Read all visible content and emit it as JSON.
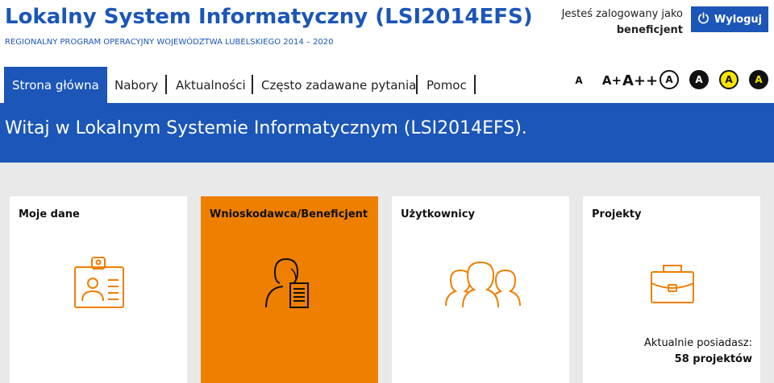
{
  "header": {
    "title": "Lokalny System Informatyczny (LSI2014EFS)",
    "subtitle": "REGIONALNY PROGRAM OPERACYJNY WOJEWÓDZTWA LUBELSKIEGO 2014 – 2020",
    "login_label": "Jesteś zalogowany jako",
    "login_user": "beneficjent",
    "logout_label": "Wyloguj",
    "logout_icon": "power-icon"
  },
  "nav": {
    "tabs": [
      {
        "label": "Strona główna",
        "active": true
      },
      {
        "label": "Nabory"
      },
      {
        "label": "Aktualności"
      },
      {
        "label": "Często zadawane pytania"
      },
      {
        "label": "Pomoc"
      }
    ]
  },
  "accessibility": {
    "font_small": "A",
    "font_medium": "A+",
    "font_large": "A++",
    "contrast": [
      "A",
      "A",
      "A",
      "A"
    ]
  },
  "banner": {
    "text": "Witaj w Lokalnym Systemie Informatycznym (LSI2014EFS)."
  },
  "cards": [
    {
      "title": "Moje dane",
      "icon": "id-card-icon"
    },
    {
      "title": "Wnioskodawca/Beneficjent",
      "icon": "person-document-icon"
    },
    {
      "title": "Użytkownicy",
      "icon": "users-icon"
    },
    {
      "title": "Projekty",
      "icon": "briefcase-icon",
      "footer_label": "Aktualnie posiadasz:",
      "footer_count": "58 projektów"
    }
  ],
  "colors": {
    "brand_blue": "#1b56b8",
    "accent_orange": "#ee7f00",
    "background": "#e9e9e9"
  }
}
